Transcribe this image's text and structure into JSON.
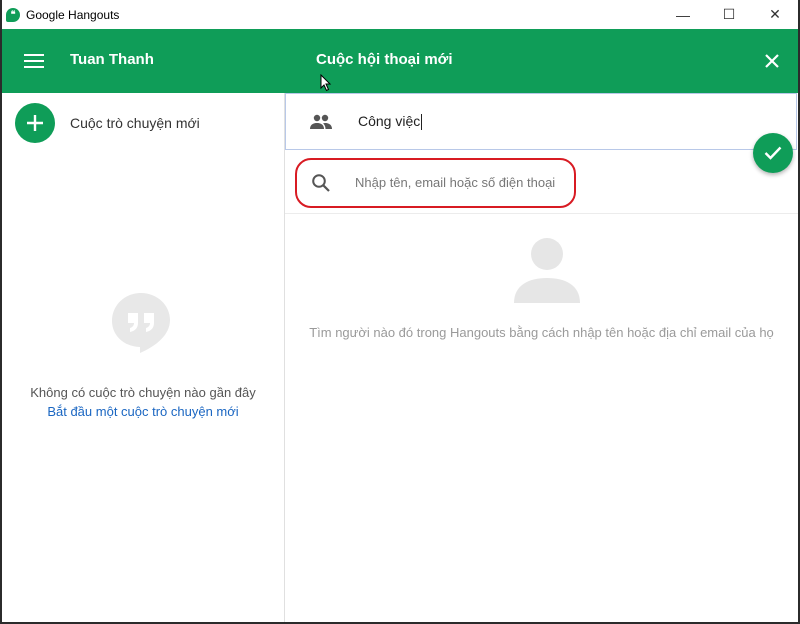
{
  "window": {
    "title": "Google Hangouts",
    "controls": {
      "minimize": "—",
      "maximize": "☐",
      "close": "✕"
    }
  },
  "appbar": {
    "user_name": "Tuan Thanh",
    "conversation_title": "Cuộc hội thoại mới"
  },
  "sidebar": {
    "new_chat_label": "Cuộc trò chuyện mới",
    "empty_message": "Không có cuộc trò chuyện nào gần đây",
    "start_link": "Bắt đầu một cuộc trò chuyện mới"
  },
  "new_conversation": {
    "group_name": "Công việc",
    "search_placeholder": "Nhập tên, email hoặc số điện thoại",
    "search_value": "",
    "hint": "Tìm người nào đó trong Hangouts bằng cách nhập tên hoặc địa chỉ email của họ"
  },
  "colors": {
    "brand_green": "#0f9d58",
    "highlight_red": "#d81b23",
    "link_blue": "#1a66c2"
  },
  "icons": [
    "hangouts-app-icon",
    "menu-icon",
    "close-icon",
    "plus-icon",
    "quote-bubble-icon",
    "group-icon",
    "check-icon",
    "search-icon",
    "person-icon",
    "cursor-icon"
  ]
}
